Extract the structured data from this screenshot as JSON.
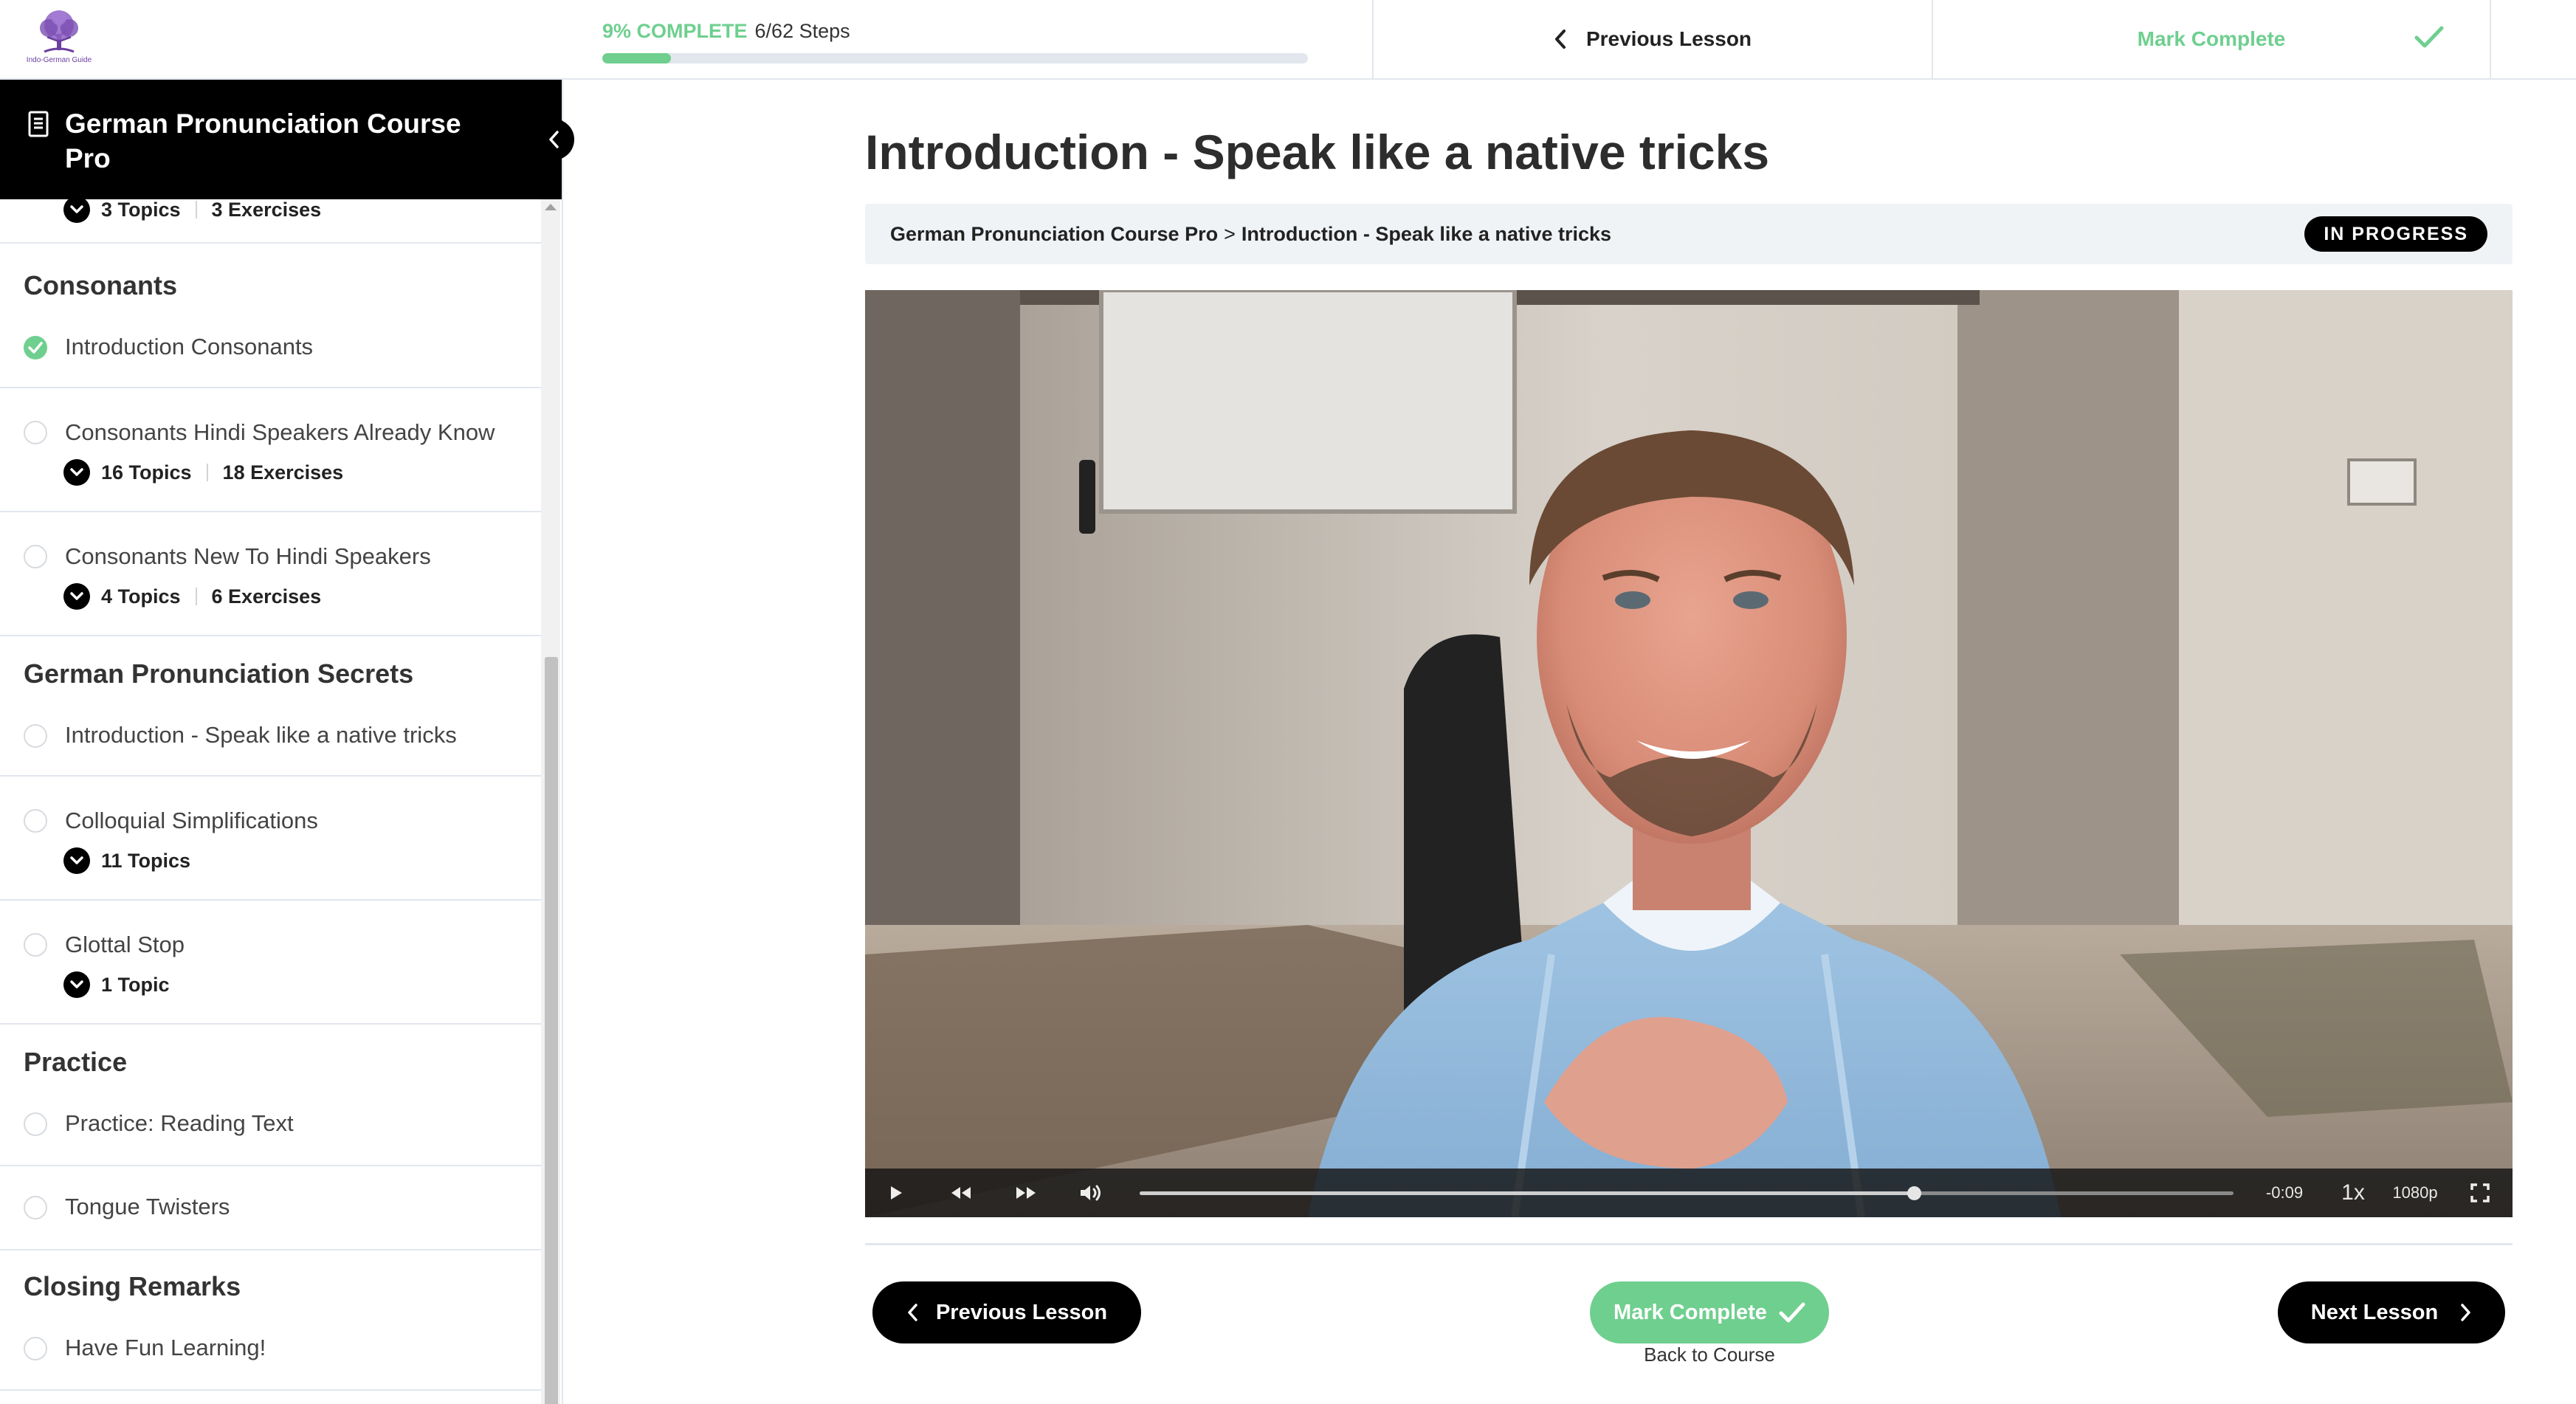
{
  "header": {
    "logo_text": "Indo-German Guide",
    "progress": {
      "percent_label": "9% COMPLETE",
      "steps_label": "6/62 Steps",
      "fraction": 0.097
    },
    "previous_label": "Previous Lesson",
    "mark_complete_label": "Mark Complete"
  },
  "sidebar": {
    "course_title": "German Pronunciation Course Pro",
    "top_partial": {
      "topics": "3 Topics",
      "exercises": "3 Exercises"
    },
    "sections": [
      {
        "title": "Consonants",
        "lessons": [
          {
            "label": "Introduction Consonants",
            "status": "complete"
          },
          {
            "label": "Consonants Hindi Speakers Already Know",
            "topics": "16 Topics",
            "exercises": "18 Exercises"
          },
          {
            "label": "Consonants New To Hindi Speakers",
            "topics": "4 Topics",
            "exercises": "6 Exercises"
          }
        ]
      },
      {
        "title": "German Pronunciation Secrets",
        "lessons": [
          {
            "label": "Introduction - Speak like a native tricks"
          },
          {
            "label": "Colloquial Simplifications",
            "topics": "11 Topics"
          },
          {
            "label": "Glottal Stop",
            "topics": "1 Topic"
          }
        ]
      },
      {
        "title": "Practice",
        "lessons": [
          {
            "label": "Practice: Reading Text"
          },
          {
            "label": "Tongue Twisters"
          }
        ]
      },
      {
        "title": "Closing Remarks",
        "lessons": [
          {
            "label": "Have Fun Learning!"
          }
        ]
      }
    ]
  },
  "main": {
    "title": "Introduction - Speak like a native tricks",
    "breadcrumb": {
      "course": "German Pronunciation Course Pro",
      "separator": ">",
      "lesson": "Introduction - Speak like a native tricks"
    },
    "status_badge": "IN PROGRESS",
    "video": {
      "time_remaining": "-0:09",
      "speed": "1x",
      "quality": "1080p",
      "played_fraction": 0.708
    },
    "footer": {
      "previous_label": "Previous Lesson",
      "mark_complete_label": "Mark Complete",
      "back_label": "Back to Course",
      "next_label": "Next Lesson"
    }
  },
  "colors": {
    "accent_green": "#6fcf8f",
    "black": "#000000",
    "border": "#e2e7ed",
    "breadcrumb_bg": "#f0f3f6",
    "logo_purple": "#6b3fa0"
  },
  "icons": {
    "logo": "tree-logo-icon",
    "header_prev": "chevron-left-icon",
    "header_mark": "check-icon",
    "course": "document-icon",
    "collapse": "chevron-left-icon",
    "expand": "chevron-down-icon",
    "complete": "check-circle-icon",
    "incomplete": "empty-circle-icon",
    "play": "play-icon",
    "rewind": "rewind-icon",
    "forward": "fast-forward-icon",
    "volume": "volume-icon",
    "fullscreen": "fullscreen-icon",
    "next": "chevron-right-icon"
  }
}
